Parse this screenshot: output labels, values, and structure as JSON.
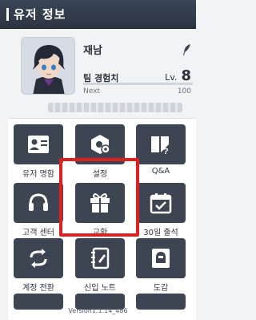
{
  "header": {
    "title": "유저 정보"
  },
  "profile": {
    "name": "재남",
    "team_exp_label": "팀 경험치",
    "level_prefix": "Lv.",
    "level": "8",
    "next_label": "Next",
    "next_value": "100",
    "exp_progress": 0
  },
  "menu": {
    "items": [
      {
        "label": "유저 명함",
        "icon": "id-card-icon"
      },
      {
        "label": "설정",
        "icon": "settings-gear-icon"
      },
      {
        "label": "Q&A",
        "icon": "qa-book-icon"
      },
      {
        "label": "고객 센터",
        "icon": "headset-icon"
      },
      {
        "label": "교환",
        "icon": "gift-box-icon"
      },
      {
        "label": "30일 출석",
        "icon": "calendar-check-icon"
      },
      {
        "label": "계정 전환",
        "icon": "switch-arrows-icon"
      },
      {
        "label": "신입 노트",
        "icon": "notebook-icon"
      },
      {
        "label": "도감",
        "icon": "codex-helmet-icon"
      }
    ]
  },
  "footer": {
    "version": "Version1.1.14_486"
  },
  "colors": {
    "header_bg": "#2f3946",
    "tile_bg": "#3d4553",
    "highlight": "#e02020"
  }
}
